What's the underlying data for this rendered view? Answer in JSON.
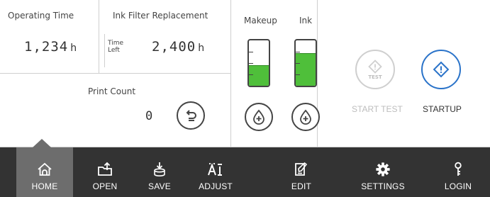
{
  "operating_time": {
    "label": "Operating Time",
    "value": "1,234",
    "unit": "h"
  },
  "ink_filter": {
    "title": "Ink Filter Replacement",
    "time_left_line1": "Time",
    "time_left_line2": "Left",
    "value": "2,400",
    "unit": "h"
  },
  "print_count": {
    "label": "Print Count",
    "value": "0"
  },
  "tanks": [
    {
      "label": "Makeup",
      "level": 0.45,
      "color": "#4fbf3a"
    },
    {
      "label": "Ink",
      "level": 0.72,
      "color": "#4fbf3a"
    }
  ],
  "actions": {
    "test_badge": "TEST",
    "start_test_label": "START TEST",
    "startup_label": "STARTUP",
    "startup_color": "#2a73c9"
  },
  "nav": {
    "active": "HOME",
    "items": [
      {
        "label": "HOME",
        "icon": "home-icon"
      },
      {
        "label": "OPEN",
        "icon": "open-folder-icon"
      },
      {
        "label": "SAVE",
        "icon": "save-icon"
      },
      {
        "label": "ADJUST",
        "icon": "adjust-icon"
      },
      {
        "label": "EDIT",
        "icon": "edit-icon"
      },
      {
        "label": "SETTINGS",
        "icon": "gear-icon"
      },
      {
        "label": "LOGIN",
        "icon": "key-icon"
      }
    ]
  }
}
